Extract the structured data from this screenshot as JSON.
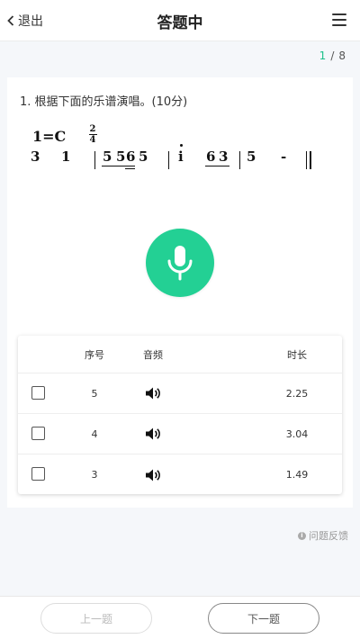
{
  "header": {
    "back_label": "退出",
    "title": "答题中"
  },
  "progress": {
    "current": "1",
    "separator": "/",
    "total": "8"
  },
  "question": {
    "text": "1.  根据下面的乐谱演唱。(10分)"
  },
  "score": {
    "key": "1=C",
    "meter_top": "2",
    "meter_bottom": "4",
    "notes": [
      "3",
      "1",
      "5",
      "5",
      "6",
      "5",
      "i",
      "6",
      "3",
      "5",
      "-"
    ]
  },
  "table": {
    "headers": {
      "number": "序号",
      "audio": "音频",
      "duration": "时长"
    },
    "rows": [
      {
        "number": "5",
        "duration": "2.25"
      },
      {
        "number": "4",
        "duration": "3.04"
      },
      {
        "number": "3",
        "duration": "1.49"
      }
    ]
  },
  "feedback": {
    "icon": "info-icon",
    "label": "问题反馈"
  },
  "footer": {
    "prev_label": "上一题",
    "next_label": "下一题"
  },
  "colors": {
    "accent": "#23d094",
    "progress_current": "#1dc08a"
  }
}
